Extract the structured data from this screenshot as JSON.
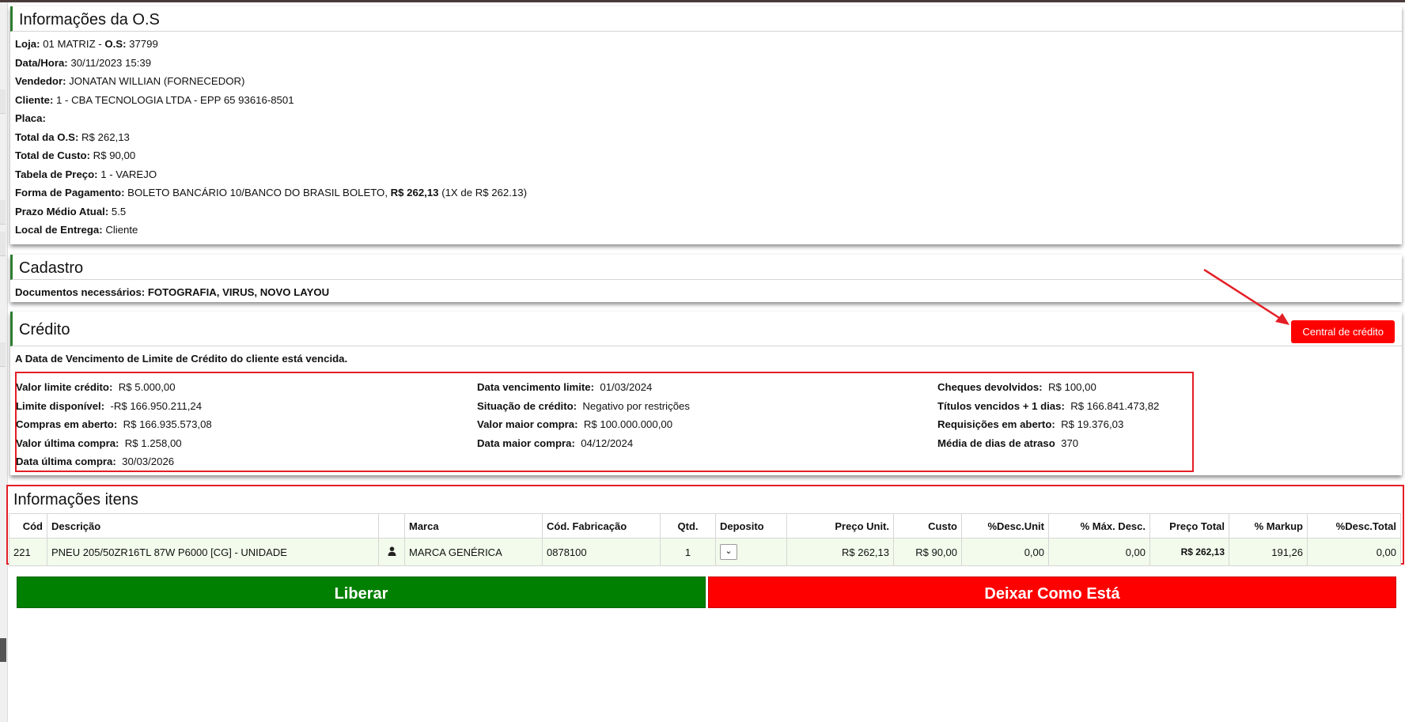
{
  "os_panel": {
    "title": "Informações da O.S",
    "loja_label": "Loja:",
    "loja_value": "01 MATRIZ -",
    "os_label": "O.S:",
    "os_value": "37799",
    "rows": [
      {
        "label": "Data/Hora:",
        "value": "30/11/2023 15:39"
      },
      {
        "label": "Vendedor:",
        "value": "JONATAN WILLIAN (FORNECEDOR)"
      },
      {
        "label": "Cliente:",
        "value": "1 - CBA TECNOLOGIA LTDA - EPP 65 93616-8501"
      },
      {
        "label": "Placa:",
        "value": ""
      },
      {
        "label": "Total da O.S:",
        "value": "R$ 262,13"
      },
      {
        "label": "Total de Custo:",
        "value": "R$ 90,00"
      },
      {
        "label": "Tabela de Preço:",
        "value": "1 - VAREJO"
      }
    ],
    "pagamento_label": "Forma de Pagamento:",
    "pagamento_value": "BOLETO BANCÁRIO 10/BANCO DO BRASIL BOLETO,",
    "pagamento_total": "R$ 262,13",
    "pagamento_parcelas": "(1X de R$ 262.13)",
    "rows2": [
      {
        "label": "Prazo Médio Atual:",
        "value": "5.5"
      },
      {
        "label": "Local de Entrega:",
        "value": "Cliente"
      }
    ]
  },
  "cadastro": {
    "title": "Cadastro",
    "docs": "Documentos necessários: FOTOGRAFIA, VIRUS, NOVO LAYOU"
  },
  "credito": {
    "title": "Crédito",
    "button": "Central de crédito",
    "warning": "A Data de Vencimento de Limite de Crédito do cliente está vencida.",
    "col1": [
      {
        "label": "Valor limite crédito:",
        "value": "R$ 5.000,00"
      },
      {
        "label": "Limite disponível:",
        "value": "-R$ 166.950.211,24"
      },
      {
        "label": "Compras em aberto:",
        "value": "R$ 166.935.573,08"
      },
      {
        "label": "Valor última compra:",
        "value": "R$ 1.258,00"
      },
      {
        "label": "Data última compra:",
        "value": "30/03/2026"
      }
    ],
    "col2": [
      {
        "label": "Data vencimento limite:",
        "value": "01/03/2024"
      },
      {
        "label": "Situação de crédito:",
        "value": "Negativo por restrições"
      },
      {
        "label": "Valor maior compra:",
        "value": "R$ 100.000.000,00"
      },
      {
        "label": "Data maior compra:",
        "value": "04/12/2024"
      }
    ],
    "col3": [
      {
        "label": "Cheques devolvidos:",
        "value": "R$ 100,00"
      },
      {
        "label": "Títulos vencidos + 1 dias:",
        "value": "R$ 166.841.473,82"
      },
      {
        "label": "Requisições em aberto:",
        "value": "R$ 19.376,03"
      },
      {
        "label": "Média de dias de atraso",
        "value": "370"
      }
    ]
  },
  "items": {
    "title": "Informações itens",
    "headers": [
      "Cód",
      "Descrição",
      "",
      "Marca",
      "Cód. Fabricação",
      "Qtd.",
      "Deposito",
      "Preço Unit.",
      "Custo",
      "%Desc.Unit",
      "% Máx. Desc.",
      "Preço Total",
      "% Markup",
      "%Desc.Total"
    ],
    "row": {
      "cod": "221",
      "descricao": "PNEU 205/50ZR16TL 87W P6000 [CG] - UNIDADE",
      "marca": "MARCA GENÉRICA",
      "cod_fabricacao": "0878100",
      "qtd": "1",
      "preco_unit": "R$ 262,13",
      "custo": "R$ 90,00",
      "desc_unit": "0,00",
      "max_desc": "0,00",
      "preco_total": "R$ 262,13",
      "markup": "191,26",
      "desc_total": "0,00"
    }
  },
  "actions": {
    "liberar": "Liberar",
    "deixar": "Deixar Como Está"
  },
  "colors": {
    "accent_green": "#2e7d32",
    "liberar_bg": "#008000",
    "deixar_bg": "#ff0000",
    "highlight_border": "#e41e26"
  }
}
